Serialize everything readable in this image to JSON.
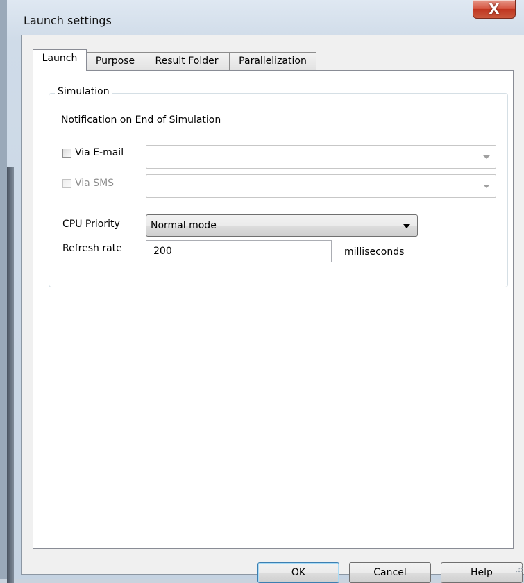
{
  "window": {
    "title": "Launch settings",
    "close_glyph": "X"
  },
  "tabs": [
    {
      "label": "Launch",
      "active": true
    },
    {
      "label": "Purpose",
      "active": false
    },
    {
      "label": "Result Folder",
      "active": false
    },
    {
      "label": "Parallelization",
      "active": false
    }
  ],
  "simulation": {
    "group_title": "Simulation",
    "notification_heading": "Notification on End of Simulation",
    "via_email": {
      "label": "Via E-mail",
      "checked": false,
      "value": ""
    },
    "via_sms": {
      "label": "Via SMS",
      "checked": false,
      "enabled": false,
      "value": ""
    },
    "cpu_priority": {
      "label": "CPU Priority",
      "value": "Normal mode"
    },
    "refresh_rate": {
      "label": "Refresh rate",
      "value": "200",
      "unit": "milliseconds"
    }
  },
  "buttons": {
    "ok": "OK",
    "cancel": "Cancel",
    "help": "Help"
  },
  "icons": {
    "close": "close-icon",
    "dropdown": "chevron-down-icon",
    "resize": "resize-grip-icon"
  }
}
